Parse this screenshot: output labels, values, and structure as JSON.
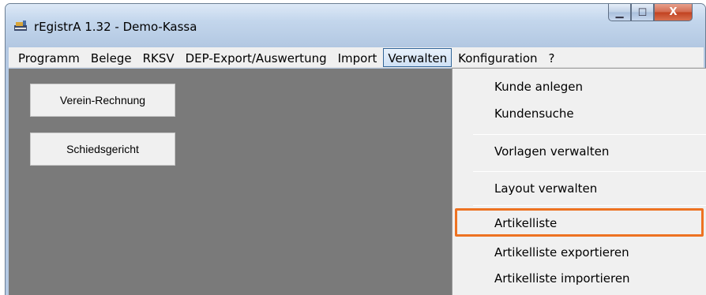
{
  "window": {
    "title": "rEgistrA 1.32 - Demo-Kassa",
    "minimize_glyph": "▁",
    "maximize_glyph": "☐",
    "close_glyph": "X"
  },
  "menubar": {
    "items": [
      "Programm",
      "Belege",
      "RKSV",
      "DEP-Export/Auswertung",
      "Import",
      "Verwalten",
      "Konfiguration",
      "?"
    ],
    "active_item": "Verwalten"
  },
  "buttons": {
    "verein_rechnung": "Verein-Rechnung",
    "schiedsgericht": "Schiedsgericht"
  },
  "dropdown": {
    "items": [
      "Kunde anlegen",
      "Kundensuche",
      "Vorlagen verwalten",
      "Layout verwalten",
      "Artikelliste",
      "Artikelliste exportieren",
      "Artikelliste importieren"
    ],
    "highlighted_item": "Artikelliste"
  },
  "colors": {
    "highlight_border": "#ed7222",
    "client_background": "#7a7a7a",
    "menu_background": "#f0f0f0"
  },
  "icons": {
    "app": "cash-register-icon"
  }
}
